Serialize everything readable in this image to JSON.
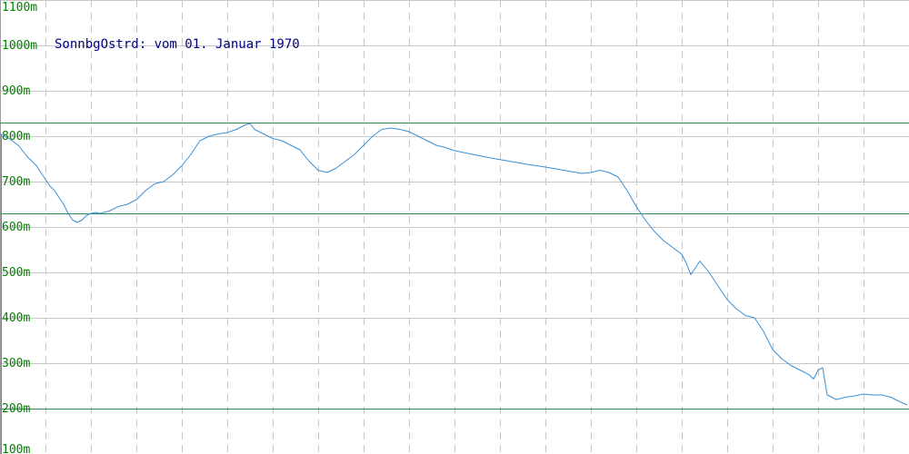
{
  "colors": {
    "background": "#ffffff",
    "grid": "#c8c8c8",
    "tick_label": "#008000",
    "reference_line": "#2e8b57",
    "series": "#3a8fd6",
    "title": "#000080",
    "axis": "#a0a0a0"
  },
  "chart_data": {
    "type": "line",
    "title": "SonnbgOstrd: vom 01. Januar 1970",
    "xlabel": "",
    "ylabel": "",
    "ylim": [
      100,
      1100
    ],
    "xlim": [
      0,
      1000
    ],
    "grid": true,
    "y_ticks": [
      100,
      200,
      300,
      400,
      500,
      600,
      700,
      800,
      900,
      1000,
      1100
    ],
    "y_tick_labels": [
      "100m",
      "200m",
      "300m",
      "400m",
      "500m",
      "600m",
      "700m",
      "800m",
      "900m",
      "1000m",
      "1100m"
    ],
    "x_grid_count": 20,
    "reference_lines": [
      830,
      630,
      200
    ],
    "series": [
      {
        "x": [
          0,
          10,
          20,
          30,
          40,
          45,
          50,
          55,
          60,
          65,
          70,
          75,
          80,
          85,
          90,
          95,
          100,
          105,
          110,
          120,
          130,
          140,
          150,
          160,
          170,
          180,
          190,
          200,
          210,
          220,
          230,
          240,
          250,
          260,
          270,
          275,
          280,
          290,
          300,
          310,
          320,
          330,
          340,
          350,
          360,
          370,
          380,
          390,
          400,
          410,
          420,
          430,
          440,
          450,
          460,
          470,
          480,
          490,
          500,
          520,
          540,
          560,
          580,
          600,
          620,
          640,
          650,
          660,
          670,
          680,
          690,
          700,
          710,
          720,
          730,
          740,
          750,
          755,
          760,
          765,
          770,
          780,
          790,
          800,
          810,
          820,
          830,
          840,
          850,
          860,
          870,
          880,
          890,
          895,
          900,
          905,
          910,
          920,
          930,
          940,
          950,
          960,
          970,
          980,
          990,
          998
        ],
        "y": [
          805,
          795,
          780,
          755,
          735,
          720,
          705,
          690,
          680,
          665,
          650,
          630,
          615,
          610,
          615,
          625,
          630,
          632,
          630,
          635,
          645,
          650,
          660,
          680,
          695,
          700,
          715,
          735,
          760,
          790,
          800,
          805,
          808,
          815,
          825,
          828,
          815,
          805,
          795,
          790,
          780,
          770,
          745,
          725,
          720,
          730,
          745,
          760,
          780,
          800,
          815,
          818,
          815,
          810,
          800,
          790,
          780,
          775,
          768,
          760,
          752,
          745,
          738,
          732,
          725,
          718,
          720,
          725,
          720,
          710,
          680,
          645,
          615,
          590,
          570,
          555,
          540,
          520,
          495,
          510,
          525,
          500,
          470,
          440,
          420,
          405,
          400,
          370,
          330,
          310,
          295,
          285,
          275,
          265,
          285,
          290,
          230,
          220,
          225,
          228,
          232,
          230,
          230,
          225,
          215,
          208
        ]
      }
    ]
  }
}
